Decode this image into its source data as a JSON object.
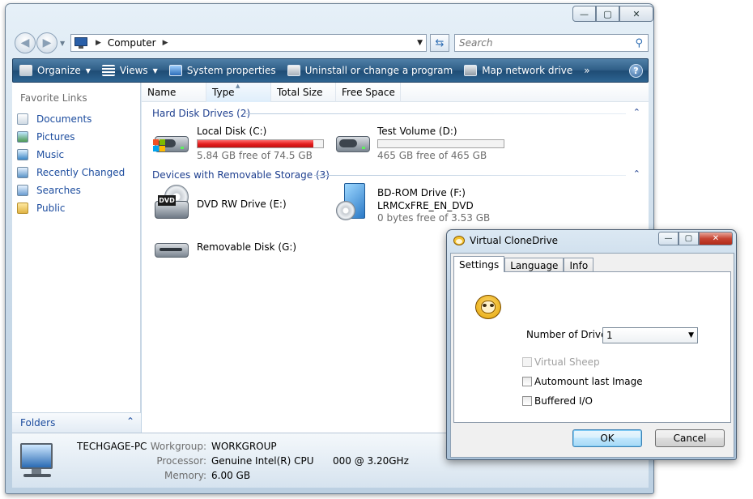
{
  "explorer": {
    "caption_buttons": {
      "minimize": "—",
      "maximize": "▢",
      "close": "✕"
    },
    "nav": {
      "back": "◀",
      "forward": "▶"
    },
    "address": {
      "location": "Computer"
    },
    "search": {
      "placeholder": "Search"
    },
    "toolbar": {
      "organize": "Organize",
      "views": "Views",
      "system_properties": "System properties",
      "uninstall": "Uninstall or change a program",
      "map_drive": "Map network drive",
      "more": "»",
      "help": "?"
    },
    "sidebar": {
      "header": "Favorite Links",
      "links": [
        "Documents",
        "Pictures",
        "Music",
        "Recently Changed",
        "Searches",
        "Public"
      ],
      "folders": "Folders"
    },
    "columns": [
      "Name",
      "Type",
      "Total Size",
      "Free Space"
    ],
    "groups": {
      "hdd": "Hard Disk Drives (2)",
      "removable": "Devices with Removable Storage (3)"
    },
    "drives": {
      "c": {
        "name": "Local Disk (C:)",
        "free": "5.84 GB free of 74.5 GB",
        "used_fraction": 0.92
      },
      "d": {
        "name": "Test Volume (D:)",
        "free": "465 GB free of 465 GB",
        "used_fraction": 0.0
      },
      "e": {
        "name": "DVD RW Drive (E:)",
        "icon_label": "DVD"
      },
      "f": {
        "name": "BD-ROM Drive (F:)",
        "label": "LRMCxFRE_EN_DVD",
        "free": "0 bytes free of 3.53 GB"
      },
      "g": {
        "name": "Removable Disk (G:)"
      }
    },
    "details": {
      "computer_name": "TECHGAGE-PC",
      "workgroup_label": "Workgroup:",
      "workgroup": "WORKGROUP",
      "processor_label": "Processor:",
      "processor": "Genuine Intel(R) CPU",
      "processor_speed": "000  @ 3.20GHz",
      "memory_label": "Memory:",
      "memory": "6.00 GB"
    }
  },
  "vcd": {
    "title": "Virtual CloneDrive",
    "tabs": [
      "Settings",
      "Language",
      "Info"
    ],
    "drives_label": "Number of Drives:",
    "drives_value": "1",
    "virtual_sheep": "Virtual Sheep",
    "automount": "Automount last Image",
    "buffered": "Buffered I/O",
    "ok": "OK",
    "cancel": "Cancel"
  },
  "colors": {
    "toolbar": "#2f5e87",
    "link": "#1c4c9e",
    "group_header": "#1e3f8f",
    "disk_full_bar": "#e21b1b"
  }
}
